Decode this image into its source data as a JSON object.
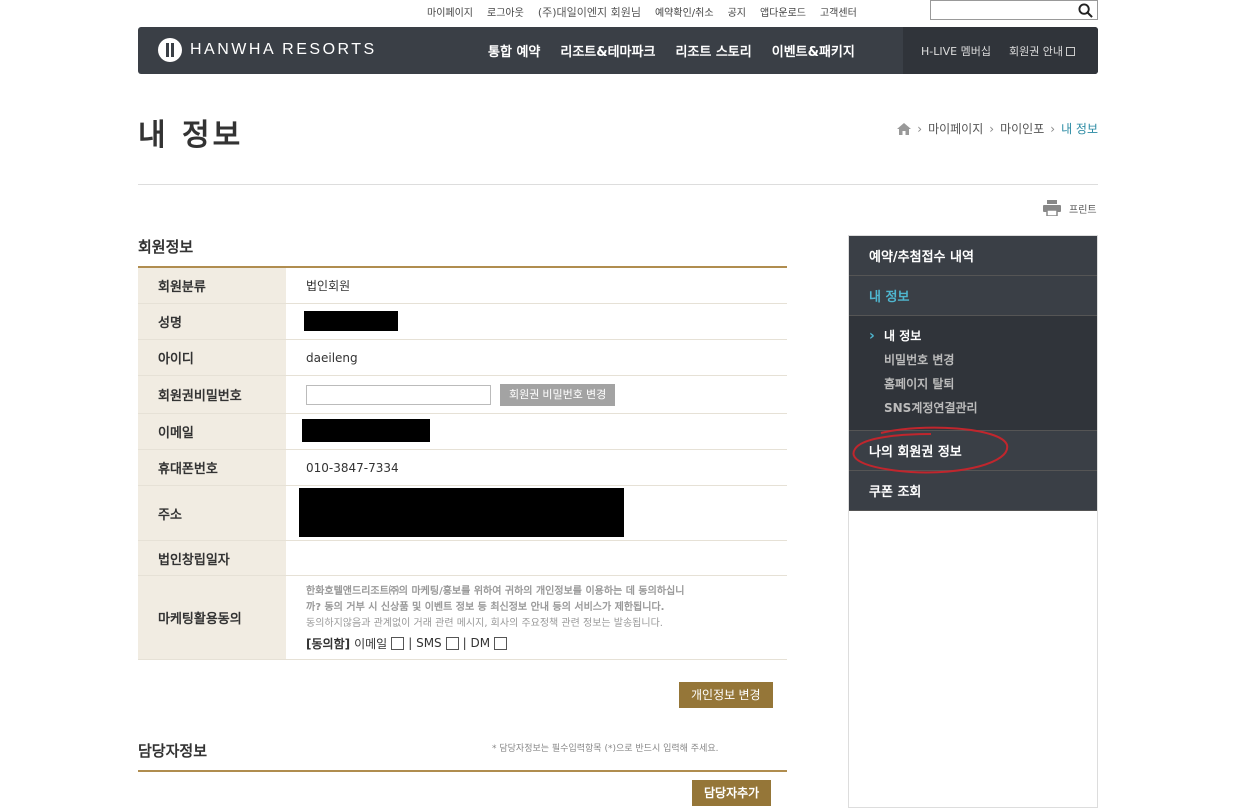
{
  "util": {
    "links": [
      "마이페이지",
      "로그아웃",
      "(주)대일이엔지 회원님",
      "예약확인/취소",
      "공지",
      "앱다운로드",
      "고객센터"
    ],
    "search_placeholder": ""
  },
  "nav": {
    "logo": "HANWHA RESORTS",
    "menu": [
      "통합 예약",
      "리조트&테마파크",
      "리조트 스토리",
      "이벤트&패키지"
    ],
    "right": [
      "H-LIVE 멤버십",
      "회원권 안내"
    ]
  },
  "page": {
    "title": "내 정보",
    "breadcrumb": [
      "마이페이지",
      "마이인포",
      "내 정보"
    ],
    "print_label": "프린트"
  },
  "member": {
    "section_title": "회원정보",
    "rows": {
      "type": {
        "label": "회원분류",
        "value": "법인회원"
      },
      "name": {
        "label": "성명"
      },
      "id": {
        "label": "아이디",
        "value": "daeileng"
      },
      "password": {
        "label": "회원권비밀번호",
        "button": "회원권 비밀번호 변경"
      },
      "email": {
        "label": "이메일"
      },
      "phone": {
        "label": "휴대폰번호",
        "value": "010-3847-7334"
      },
      "address": {
        "label": "주소"
      },
      "founded": {
        "label": "법인창립일자",
        "value": ""
      },
      "marketing": {
        "label": "마케팅활용동의",
        "text1": "한화호텔앤드리조트㈜의 마케팅/홍보를 위하여 귀하의 개인정보를 이용하는 데 동의하십니",
        "text2": "까? 동의 거부 시 신상품 및 이벤트 정보 등 최신정보 안내 등의 서비스가 제한됩니다.",
        "text3": "동의하지않음과 관계없이 거래 관련 메시지, 회사의 주요정책 관련 정보는 발송됩니다.",
        "agree_label": "[동의함]",
        "opt_email": "이메일",
        "opt_sms": "| SMS",
        "opt_dm": "| DM"
      }
    },
    "edit_button": "개인정보 변경"
  },
  "manager": {
    "section_title": "담당자정보",
    "note": "* 담당자정보는 필수입력항목 (*)으로 반드시 입력해 주세요.",
    "add_button": "담당자추가"
  },
  "sidebar": {
    "items": [
      "예약/추첨접수 내역",
      "내 정보",
      "나의 회원권 정보",
      "쿠폰 조회"
    ],
    "sub": [
      "내 정보",
      "비밀번호 변경",
      "홈페이지 탈퇴",
      "SNS계정연결관리"
    ]
  }
}
